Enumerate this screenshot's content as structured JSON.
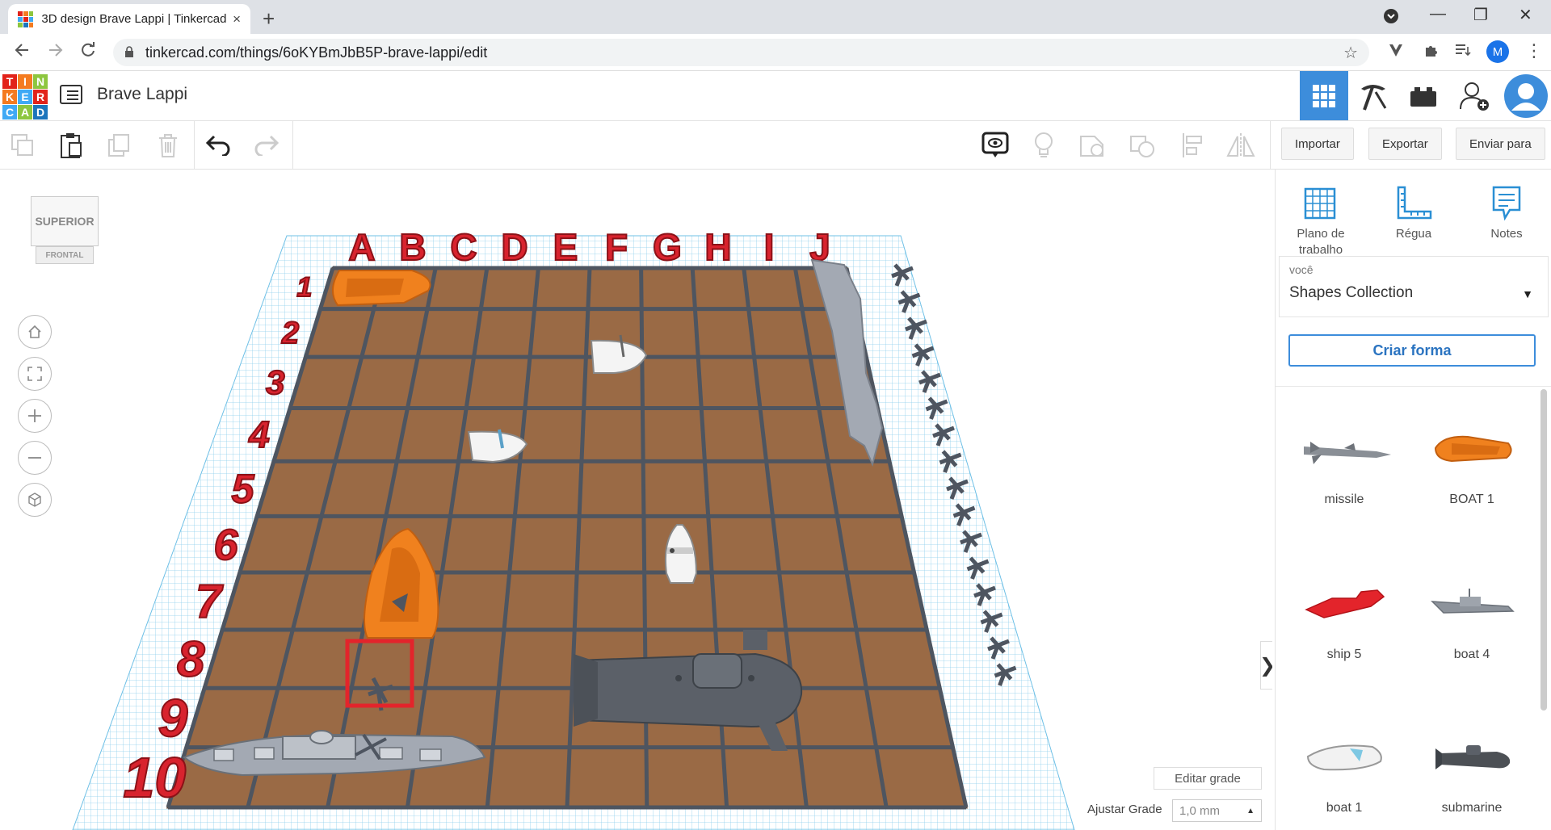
{
  "browser": {
    "tab_title": "3D design Brave Lappi | Tinkercad",
    "tab_close": "×",
    "new_tab": "+",
    "url": "tinkercad.com/things/6oKYBmJbB5P-brave-lappi/edit",
    "profile_initial": "M",
    "window_controls": {
      "minimize": "—",
      "maximize": "❐",
      "close": "✕"
    }
  },
  "app": {
    "logo_letters": [
      "T",
      "I",
      "N",
      "K",
      "E",
      "R",
      "C",
      "A",
      "D"
    ],
    "logo_colors": [
      "#e2231a",
      "#f47b20",
      "#8dc63f",
      "#f47b20",
      "#3fa9f5",
      "#e2231a",
      "#3fa9f5",
      "#8dc63f",
      "#1c75bc"
    ],
    "design_name": "Brave Lappi",
    "accent": "#3d8ddb"
  },
  "toolbar": {
    "import_label": "Importar",
    "export_label": "Exportar",
    "send_label": "Enviar para"
  },
  "viewport": {
    "viewcube_top": "SUPERIOR",
    "viewcube_front": "FRONTAL",
    "edit_grid_label": "Editar grade",
    "snap_label": "Ajustar Grade",
    "snap_value": "1,0 mm",
    "column_letters": [
      "A",
      "B",
      "C",
      "D",
      "E",
      "F",
      "G",
      "H",
      "I",
      "J"
    ],
    "row_numbers": [
      "1",
      "2",
      "3",
      "4",
      "5",
      "6",
      "7",
      "8",
      "9",
      "10"
    ],
    "board_color": "#9a6a45",
    "letter_color": "#d8232e"
  },
  "panel": {
    "tools": [
      {
        "label": "Plano de trabalho",
        "icon": "workplane-icon"
      },
      {
        "label": "Régua",
        "icon": "ruler-icon"
      },
      {
        "label": "Notes",
        "icon": "notes-icon"
      }
    ],
    "library_small_label": "você",
    "library_value": "Shapes Collection",
    "create_shape_label": "Criar forma",
    "shapes": [
      {
        "name": "missile",
        "color": "#8a8f96"
      },
      {
        "name": "BOAT 1",
        "color": "#f0811e"
      },
      {
        "name": "ship 5",
        "color": "#e3242b"
      },
      {
        "name": "boat 4",
        "color": "#8d939b"
      },
      {
        "name": "boat 1",
        "color": "#e8e8e8"
      },
      {
        "name": "submarine",
        "color": "#4c5055"
      }
    ]
  }
}
